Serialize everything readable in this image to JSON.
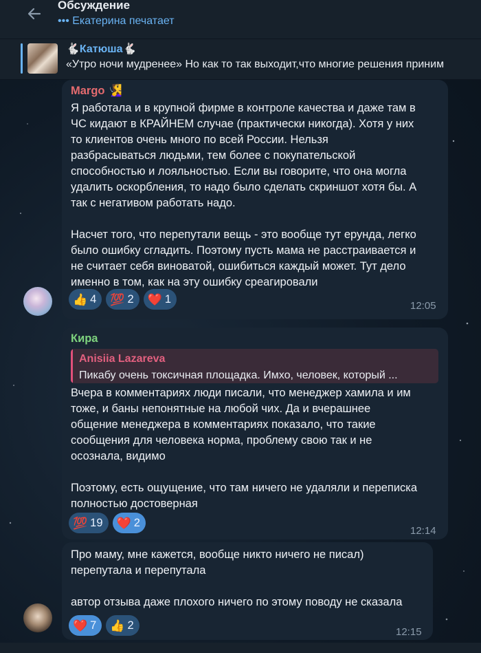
{
  "header": {
    "title": "Обсуждение",
    "subtitle": "••• Екатерина печатает"
  },
  "pinned": {
    "name": "🐇Катюша🐇",
    "text": "«Утро ночи мудренее»  Но как то так выходит,что многие решения приним"
  },
  "messages": [
    {
      "sender": "Margo 🧏‍♀️",
      "sender_color": "#e56b6f",
      "text": "Я работала и в крупной фирме в контроле качества и даже там в\nЧС кидают в КРАЙНЕМ случае (практически никогда). Хотя у них\nто клиентов очень много по всей России. Нельзя\nразбрасываться людьми, тем более с покупательской\nспособностью и лояльностью. Если вы говорите, что она могла\nудалить оскорбления, то надо было сделать скриншот хотя бы. А\nтак с негативом работать надо.\n\nНасчет того, что перепутали вещь - это вообще тут ерунда, легко\nбыло ошибку сгладить. Поэтому пусть мама не расстраивается и\nне считает себя виноватой, ошибиться каждый может. Тут дело\nименно в том, как на эту ошибку среагировали",
      "reactions": [
        {
          "emoji": "👍",
          "count": "4"
        },
        {
          "emoji": "💯",
          "count": "2"
        },
        {
          "emoji": "❤️",
          "count": "1"
        }
      ],
      "time": "12:05"
    },
    {
      "sender": "Кира",
      "sender_color": "#7ed37e",
      "reply": {
        "name": "Anisiia Lazareva",
        "text": "Пикабу очень токсичная площадка. Имхо, человек, который ..."
      },
      "text": "Вчера в комментариях люди писали, что менеджер хамила и им\nтоже, и баны непонятные на любой чих. Да и вчерашнее\nобщение менеджера в комментариях показало, что такие\nсообщения для человека норма, проблему свою так и не\nосознала, видимо\n\nПоэтому, есть ощущение, что там ничего не удаляли и переписка\nполностью достоверная",
      "reactions": [
        {
          "emoji": "💯",
          "count": "19"
        },
        {
          "emoji": "❤️",
          "count": "2"
        }
      ],
      "time": "12:14"
    },
    {
      "text": "Про маму, мне кажется, вообще никто ничего не писал)\n перепутала и перепутала\n\nавтор отзыва даже плохого ничего по этому поводу не сказала",
      "reactions": [
        {
          "emoji": "❤️",
          "count": "7"
        },
        {
          "emoji": "👍",
          "count": "2"
        }
      ],
      "time": "12:15"
    }
  ],
  "colors": {
    "accent": "#6ab3f3",
    "bubble": "#182533",
    "reaction": "#2b5278"
  }
}
